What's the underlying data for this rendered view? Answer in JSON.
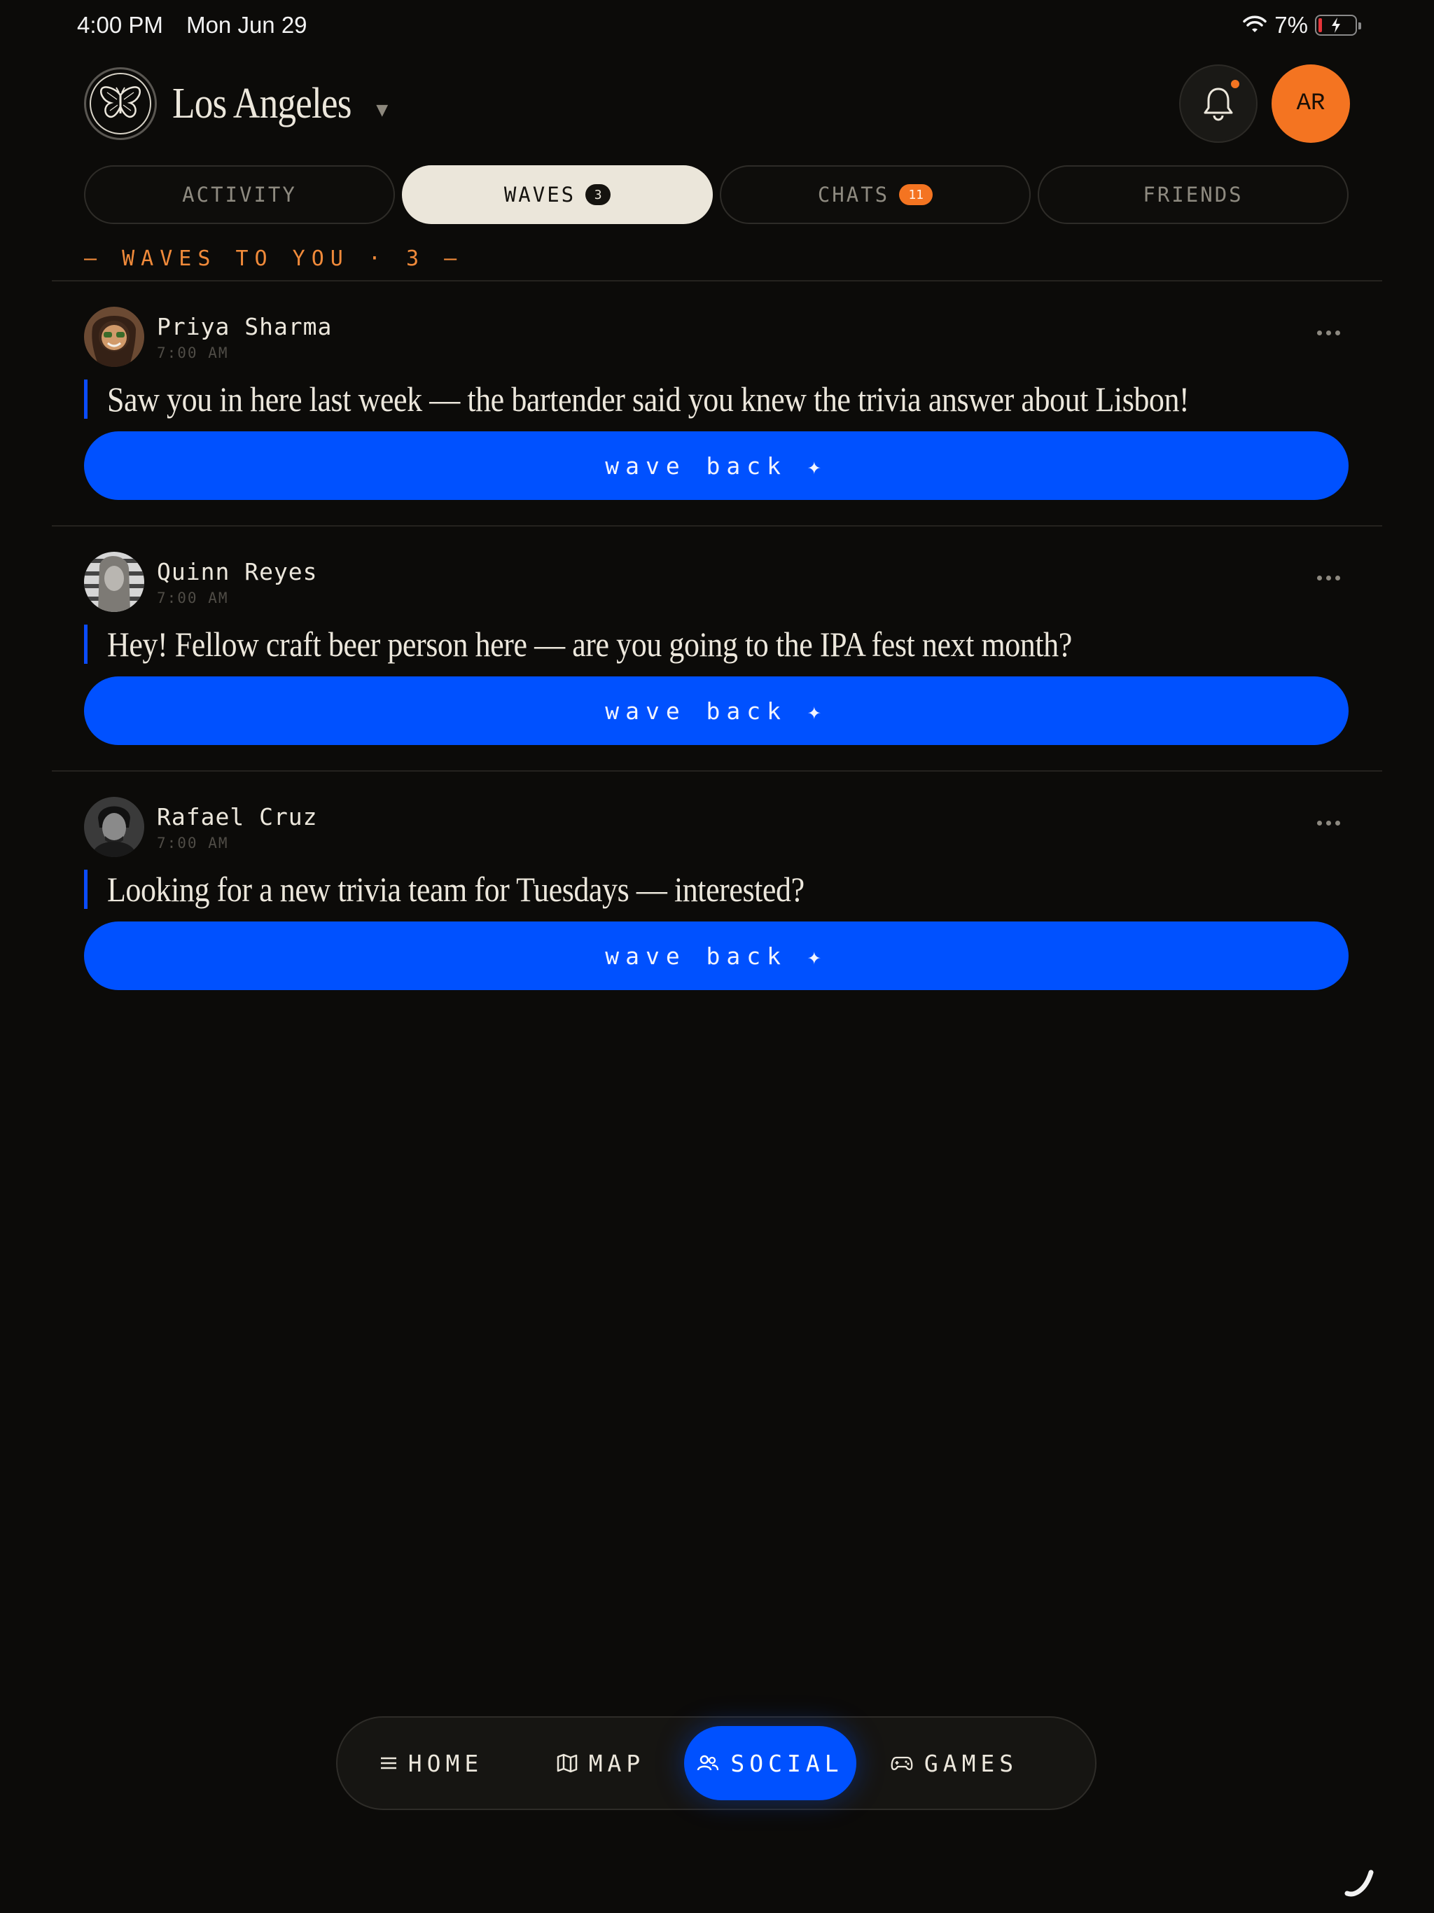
{
  "status": {
    "time": "4:00 PM",
    "date": "Mon Jun 29",
    "battery": "7%"
  },
  "header": {
    "city": "Los Angeles",
    "avatar_initials": "AR"
  },
  "tabs": [
    {
      "label": "ACTIVITY",
      "badge": ""
    },
    {
      "label": "WAVES",
      "badge": "3"
    },
    {
      "label": "CHATS",
      "badge": "11"
    },
    {
      "label": "FRIENDS",
      "badge": ""
    }
  ],
  "section": {
    "label": "— WAVES TO YOU · 3 —"
  },
  "waves": [
    {
      "name": "Priya Sharma",
      "time": "7:00 AM",
      "message": "Saw you in here last week — the bartender said you knew the trivia answer about Lisbon!",
      "button": "wave back ✦"
    },
    {
      "name": "Quinn Reyes",
      "time": "7:00 AM",
      "message": "Hey! Fellow craft beer person here — are you going to the IPA fest next month?",
      "button": "wave back ✦"
    },
    {
      "name": "Rafael Cruz",
      "time": "7:00 AM",
      "message": "Looking for a new trivia team for Tuesdays — interested?",
      "button": "wave back ✦"
    }
  ],
  "nav": [
    {
      "label": "HOME",
      "icon": "menu-icon"
    },
    {
      "label": "MAP",
      "icon": "map-icon"
    },
    {
      "label": "SOCIAL",
      "icon": "people-icon"
    },
    {
      "label": "GAMES",
      "icon": "gamepad-icon"
    }
  ],
  "colors": {
    "accent_blue": "#0051ff",
    "accent_orange": "#f47421",
    "background": "#0c0b09",
    "cream": "#ebe6da"
  }
}
